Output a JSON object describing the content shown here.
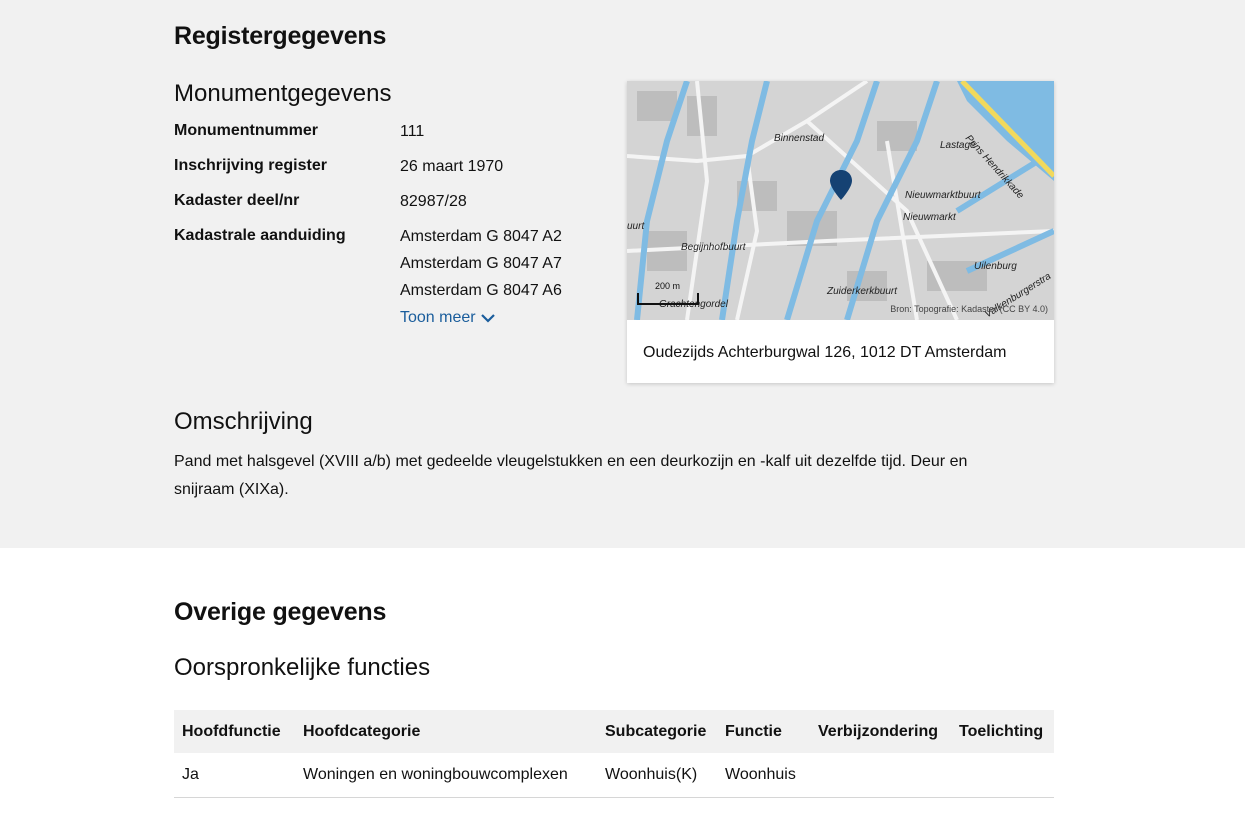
{
  "register": {
    "title": "Registergegevens",
    "monument_title": "Monumentgegevens",
    "fields": {
      "monumentnummer_label": "Monumentnummer",
      "monumentnummer_value": "111",
      "inschrijving_label": "Inschrijving register",
      "inschrijving_value": "26 maart 1970",
      "kadaster_label": "Kadaster deel/nr",
      "kadaster_value": "82987/28",
      "kadastrale_label": "Kadastrale aanduiding",
      "kadastrale_values": [
        "Amsterdam G 8047 A2",
        "Amsterdam G 8047 A7",
        "Amsterdam G 8047 A6"
      ],
      "toon_meer": "Toon meer"
    },
    "map": {
      "labels": {
        "binnenstad": "Binnenstad",
        "lastage": "Lastage",
        "prins": "Prins Hendrikkade",
        "nieuwmarktbuurt": "Nieuwmarktbuurt",
        "nieuwmarkt": "Nieuwmarkt",
        "uilenburg": "Uilenburg",
        "begijnhofbuurt": "Begijnhofbuurt",
        "zuiderkerkbuurt": "Zuiderkerkbuurt",
        "grachtengordel": "Grachtengordel",
        "valkenburger": "Valkenburgerstra",
        "uurt": "uurt"
      },
      "scale": "200 m",
      "attribution": "Bron: Topografie: Kadaster (CC BY 4.0)",
      "address": "Oudezijds Achterburgwal 126, 1012 DT Amsterdam",
      "water_color": "#7fbbe3",
      "marker_color": "#154273"
    },
    "omschrijving_title": "Omschrijving",
    "omschrijving_text": "Pand met halsgevel (XVIII a/b) met gedeelde vleugelstukken en een deurkozijn en -kalf uit dezelfde tijd. Deur en snijraam (XIXa)."
  },
  "overige": {
    "title": "Overige gegevens",
    "functies_title": "Oorspronkelijke functies",
    "table": {
      "headers": [
        "Hoofdfunctie",
        "Hoofdcategorie",
        "Subcategorie",
        "Functie",
        "Verbijzondering",
        "Toelichting"
      ],
      "rows": [
        [
          "Ja",
          "Woningen en woningbouwcomplexen",
          "Woonhuis(K)",
          "Woonhuis",
          "",
          ""
        ]
      ]
    }
  }
}
